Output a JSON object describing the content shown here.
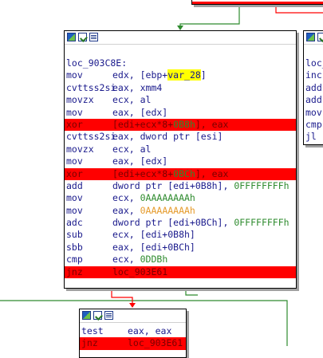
{
  "main_block": {
    "lines": [
      {
        "type": "label",
        "text": "loc_903C8E:"
      },
      {
        "type": "ins",
        "mnem": "mov",
        "ops": [
          {
            "t": "edx, [ebp+"
          },
          {
            "t": "var_28",
            "c": "var"
          },
          {
            "t": "]"
          }
        ]
      },
      {
        "type": "ins",
        "mnem": "cvttss2si",
        "ops": [
          {
            "t": "eax, xmm4"
          }
        ]
      },
      {
        "type": "ins",
        "mnem": "movzx",
        "ops": [
          {
            "t": "ecx, al"
          }
        ]
      },
      {
        "type": "ins",
        "mnem": "mov",
        "ops": [
          {
            "t": "eax, [edx]"
          }
        ]
      },
      {
        "type": "ins",
        "mnem": "xor",
        "hl": true,
        "ops": [
          {
            "t": "[edi+ecx*8+"
          },
          {
            "t": "0B8h",
            "c": "imm"
          },
          {
            "t": "], eax"
          }
        ]
      },
      {
        "type": "ins",
        "mnem": "cvttss2si",
        "ops": [
          {
            "t": "eax, dword ptr [esi]"
          }
        ]
      },
      {
        "type": "ins",
        "mnem": "movzx",
        "ops": [
          {
            "t": "ecx, al"
          }
        ]
      },
      {
        "type": "ins",
        "mnem": "mov",
        "ops": [
          {
            "t": "eax, [edx]"
          }
        ]
      },
      {
        "type": "ins",
        "mnem": "xor",
        "hl": true,
        "ops": [
          {
            "t": "[edi+ecx*8+"
          },
          {
            "t": "0BCh",
            "c": "imm"
          },
          {
            "t": "], eax"
          }
        ]
      },
      {
        "type": "ins",
        "mnem": "add",
        "ops": [
          {
            "t": "dword ptr [edi+0B8h], "
          },
          {
            "t": "0FFFFFFFFh",
            "c": "imm"
          }
        ]
      },
      {
        "type": "ins",
        "mnem": "mov",
        "ops": [
          {
            "t": "ecx, "
          },
          {
            "t": "0AAAAAAAAh",
            "c": "imm"
          }
        ]
      },
      {
        "type": "ins",
        "mnem": "mov",
        "ops": [
          {
            "t": "eax, "
          },
          {
            "t": "0AAAAAAAAh",
            "c": "imm2"
          }
        ]
      },
      {
        "type": "ins",
        "mnem": "adc",
        "ops": [
          {
            "t": "dword ptr [edi+0BCh], "
          },
          {
            "t": "0FFFFFFFFh",
            "c": "imm"
          }
        ]
      },
      {
        "type": "ins",
        "mnem": "sub",
        "ops": [
          {
            "t": "ecx, [edi+0B8h]"
          }
        ]
      },
      {
        "type": "ins",
        "mnem": "sbb",
        "ops": [
          {
            "t": "eax, [edi+0BCh]"
          }
        ]
      },
      {
        "type": "ins",
        "mnem": "cmp",
        "ops": [
          {
            "t": "ecx, "
          },
          {
            "t": "0DDBh",
            "c": "imm"
          }
        ]
      },
      {
        "type": "ins",
        "mnem": "jnz",
        "hl": true,
        "ops": [
          {
            "t": "loc_903E61"
          }
        ]
      }
    ]
  },
  "right_block": {
    "lines": [
      {
        "type": "label",
        "text": "loc_"
      },
      {
        "type": "ins",
        "mnem": "inc",
        "ops": []
      },
      {
        "type": "ins",
        "mnem": "add",
        "ops": []
      },
      {
        "type": "ins",
        "mnem": "add",
        "ops": []
      },
      {
        "type": "ins",
        "mnem": "mov",
        "ops": []
      },
      {
        "type": "ins",
        "mnem": "cmp",
        "ops": []
      },
      {
        "type": "ins",
        "mnem": "jl",
        "ops": []
      }
    ]
  },
  "bottom_block": {
    "lines": [
      {
        "type": "ins",
        "mnem": "test",
        "ops": [
          {
            "t": "eax, eax"
          }
        ]
      },
      {
        "type": "ins",
        "mnem": "jnz",
        "hl": true,
        "ops": [
          {
            "t": "loc_903E61"
          }
        ]
      }
    ]
  },
  "colors": {
    "highlight": "#ff0000",
    "edge_green": "#2e8b2e",
    "edge_red": "#ff0000",
    "var_highlight": "#ffff00"
  },
  "icons": [
    "graph-node-icon",
    "edit-node-icon",
    "node-info-icon"
  ]
}
